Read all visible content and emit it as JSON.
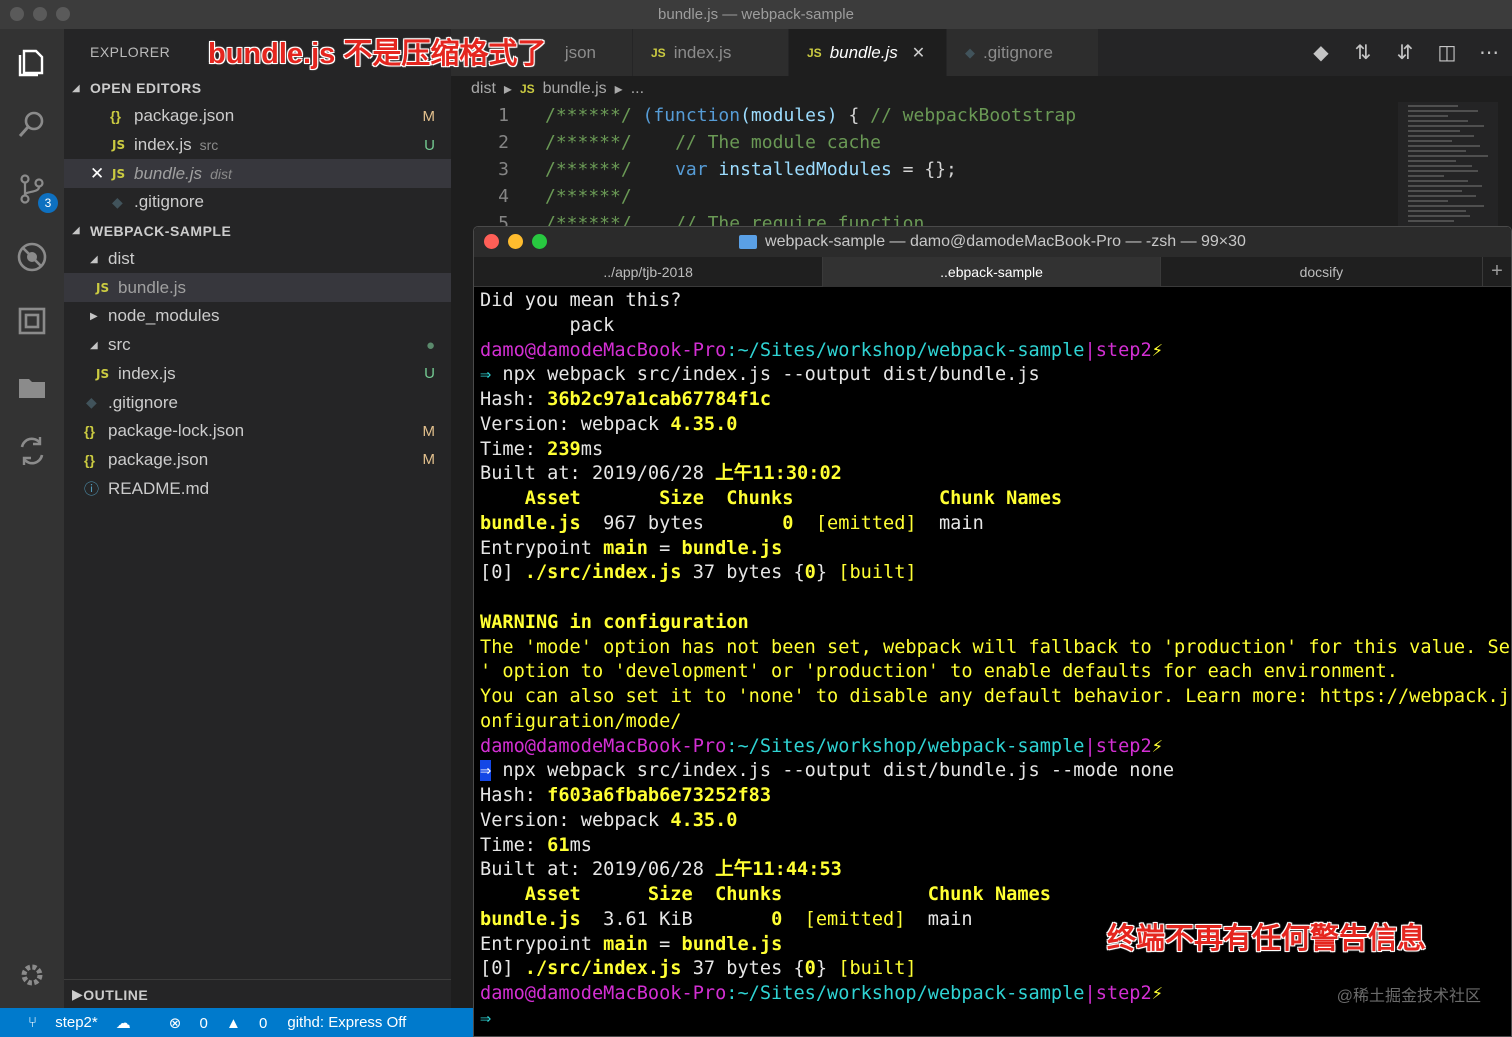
{
  "window": {
    "title": "bundle.js — webpack-sample"
  },
  "activity": {
    "badge": "3"
  },
  "sidebar": {
    "explorer_label": "EXPLORER",
    "open_editors_label": "OPEN EDITORS",
    "open_editors": [
      {
        "icon": "json-icon",
        "name": "package.json",
        "hint": "",
        "status": "M"
      },
      {
        "icon": "js-icon",
        "name": "index.js",
        "hint": "src",
        "status": "U"
      },
      {
        "icon": "js-icon",
        "name": "bundle.js",
        "hint": "dist",
        "status": ""
      },
      {
        "icon": "git-icon",
        "name": ".gitignore",
        "hint": "",
        "status": ""
      }
    ],
    "project_label": "WEBPACK-SAMPLE",
    "tree": {
      "dist": "dist",
      "bundle": "bundle.js",
      "node_modules": "node_modules",
      "src": "src",
      "src_index": "index.js",
      "gitignore": ".gitignore",
      "package_lock": "package-lock.json",
      "package": "package.json",
      "readme": "README.md"
    },
    "status_m": "M",
    "status_u": "U",
    "outline_label": "OUTLINE",
    "json_glyph": "{}",
    "js_glyph": "JS"
  },
  "tabs": [
    {
      "label": "json",
      "active": false
    },
    {
      "label": "index.js",
      "active": false
    },
    {
      "label": "bundle.js",
      "active": true
    },
    {
      "label": ".gitignore",
      "active": false
    }
  ],
  "breadcrumb": {
    "folder": "dist",
    "file": "bundle.js",
    "more": "..."
  },
  "editor": {
    "lines": [
      {
        "n": "1",
        "comment": "/******/",
        "rest_kw": "(function",
        "rest_var": "(modules)",
        "rest_punc": " { ",
        "rest_cm": "// webpackBootstrap"
      },
      {
        "n": "2",
        "comment": "/******/",
        "rest_cm": "// The module cache"
      },
      {
        "n": "3",
        "comment": "/******/",
        "kw": "var",
        "var": "installedModules",
        "punc": " = {};"
      },
      {
        "n": "4",
        "comment": "/******/"
      },
      {
        "n": "5",
        "comment": "/******/",
        "rest_cm": "// The require function"
      }
    ]
  },
  "annotations": {
    "top": "bundle.js 不是压缩格式了",
    "bottom": "终端不再有任何警告信息"
  },
  "terminal": {
    "title": "webpack-sample — damo@damodeMacBook-Pro — -zsh — 99×30",
    "tabs": [
      "../app/tjb-2018",
      "..ebpack-sample",
      "docsify"
    ],
    "prompt_user": "damo",
    "prompt_host": "@damodeMacBook-Pro",
    "prompt_path": ":~/Sites/workshop/webpack-sample",
    "prompt_branch": "|step2",
    "prompt_bolt": "⚡",
    "arrow": "⇒",
    "did_you_mean": "Did you mean this?",
    "suggestion": "        pack",
    "cmd1": " npx webpack src/index.js --output dist/bundle.js",
    "cmd2": " npx webpack src/index.js --output dist/bundle.js --mode none",
    "hash_label": "Hash: ",
    "hash1": "36b2c97a1cab67784f1c",
    "hash2": "f603a6fbab6e73252f83",
    "version_label": "Version: webpack ",
    "version": "4.35.0",
    "time_label": "Time: ",
    "time1": "239",
    "time2": "61",
    "ms": "ms",
    "built_label": "Built at: 2019/06/28 ",
    "built1": "上午11:30:02",
    "built2": "上午11:44:53",
    "header1": "    Asset       Size  Chunks             Chunk Names",
    "header2": "    Asset      Size  Chunks             Chunk Names",
    "asset": "bundle.js",
    "size1": "  967 bytes       ",
    "size2": "  3.61 KiB       ",
    "chunk": "0",
    "emitted": "[emitted]",
    "chunk_name": "main",
    "entry_label": "Entrypoint ",
    "entry_main": "main",
    "entry_eq": " = ",
    "mod_idx": "[0] ",
    "mod_path": "./src/index.js",
    "mod_size": " 37 bytes {",
    "mod_close": "} ",
    "built_tag": "[built]",
    "warning": [
      "WARNING in configuration",
      "The 'mode' option has not been set, webpack will fallback to 'production' for this value. Set 'mode",
      "' option to 'development' or 'production' to enable defaults for each environment.",
      "You can also set it to 'none' to disable any default behavior. Learn more: https://webpack.js.org/c",
      "onfiguration/mode/"
    ]
  },
  "watermark": "@稀土掘金技术社区",
  "statusbar": {
    "branch": "step2*",
    "errors": "0",
    "warnings": "0",
    "githd": "githd: Express Off"
  }
}
